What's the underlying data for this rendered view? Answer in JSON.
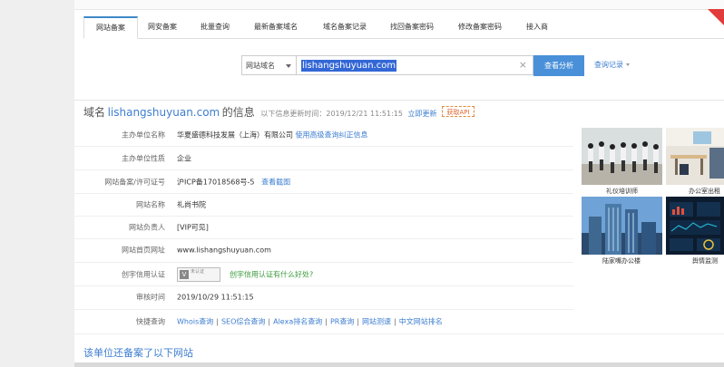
{
  "tabs": [
    "网站备案",
    "网安备案",
    "批量查询",
    "最新备案域名",
    "域名备案记录",
    "找回备案密码",
    "修改备案密码",
    "接入商"
  ],
  "search": {
    "select_label": "网站域名",
    "input_value": "lishangshuyuan.com",
    "clear_icon": "×",
    "button_label": "查看分析",
    "history_label": "查询记录"
  },
  "header": {
    "prefix": "域名",
    "domain": "lishangshuyuan.com",
    "suffix": "的信息",
    "update_time": "以下信息更新时间：2019/12/21 11:51:15",
    "refresh_link": "立即更新",
    "api_label": "获取API"
  },
  "rows": [
    {
      "label": "主办单位名称",
      "value": "华夏盛德科技发展（上海）有限公司",
      "link": "使用高级查询纠正信息"
    },
    {
      "label": "主办单位性质",
      "value": "企业"
    },
    {
      "label": "网站备案/许可证号",
      "value": "沪ICP备17018568号-5",
      "link": "查看截图"
    },
    {
      "label": "网站名称",
      "value": "礼尚书院"
    },
    {
      "label": "网站负责人",
      "link": "[VIP可见]"
    },
    {
      "label": "网站首页网址",
      "value": "www.lishangshuyuan.com"
    },
    {
      "label": "创宇信用认证",
      "badge_text": "未认证",
      "green_link": "创宇信用认证有什么好处?"
    },
    {
      "label": "审核时间",
      "value": "2019/10/29 11:51:15"
    },
    {
      "label": "快捷查询",
      "links": [
        "Whois查询",
        "SEO综合查询",
        "Alexa排名查询",
        "PR查询",
        "网站测速",
        "中文网站排名"
      ],
      "separator": "|"
    }
  ],
  "images": [
    {
      "caption": "礼仪培训师"
    },
    {
      "caption": "办公室出租"
    },
    {
      "caption": "陆家嘴办公楼"
    },
    {
      "caption": "舆情监测"
    }
  ],
  "footer": "该单位还备案了以下网站"
}
